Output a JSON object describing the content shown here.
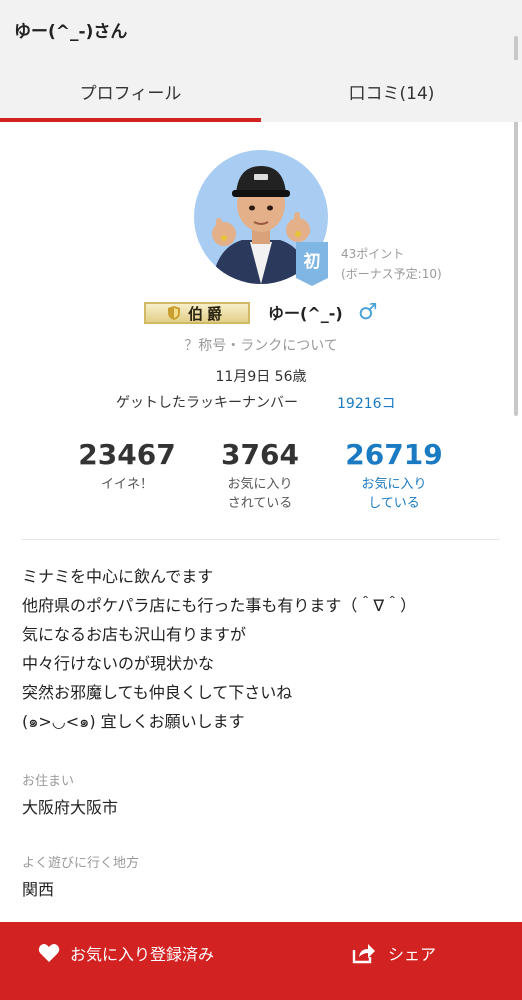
{
  "header": {
    "title": "ゆー(^_-)さん"
  },
  "tabs": [
    {
      "label": "プロフィール",
      "active": true
    },
    {
      "label": "口コミ(14)",
      "active": false
    }
  ],
  "profile": {
    "beginner_badge": "初",
    "points": "43ポイント",
    "bonus": "(ボーナス予定:10)",
    "rank_title": "伯爵",
    "username": "ゆー(^_-)",
    "gender_icon": "♂",
    "rank_help": "？称号・ランクについて",
    "birthday": "11月9日 56歳",
    "lucky_label": "ゲットしたラッキーナンバー",
    "lucky_number": "19216コ"
  },
  "stats": {
    "likes": {
      "value": "23467",
      "label": "イイネ！"
    },
    "favorited": {
      "value": "3764",
      "label1": "お気に入り",
      "label2": "されている"
    },
    "favoriting": {
      "value": "26719",
      "label1": "お気に入り",
      "label2": "している"
    }
  },
  "bio": [
    "ミナミを中心に飲んでます",
    "他府県のポケパラ店にも行った事も有ります（＾∇＾）",
    "気になるお店も沢山有りますが",
    "中々行けないのが現状かな",
    "突然お邪魔しても仲良くして下さいね",
    "(๑>◡<๑) 宜しくお願いします"
  ],
  "details": {
    "residence_label": "お住まい",
    "residence": "大阪府大阪市",
    "area_label": "よく遊びに行く地方",
    "area": "関西"
  },
  "footer": {
    "favorite_label": "お気に入り登録済み",
    "share_label": "シェア"
  },
  "colors": {
    "accent": "#d32222",
    "link": "#1a7ac2",
    "avatar_bg": "#a9cdf2",
    "badge_bg": "#7fb6e3"
  },
  "icons": [
    "heart-icon",
    "share-icon",
    "male-icon",
    "shield-icon",
    "beginner-badge-icon"
  ]
}
